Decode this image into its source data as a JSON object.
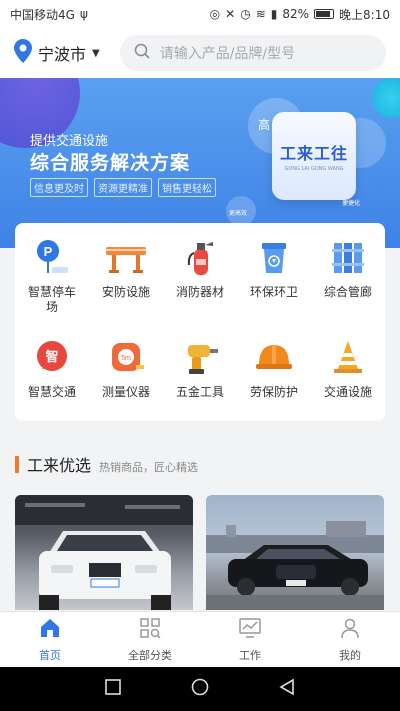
{
  "status": {
    "carrier": "中国移动4G",
    "battery": "82%",
    "time": "晚上8:10"
  },
  "header": {
    "city": "宁波市",
    "search_placeholder": "请输入产品/品牌/型号"
  },
  "banner": {
    "subtitle": "提供交通设施",
    "title": "综合服务解决方案",
    "tags": [
      "信息更及时",
      "资源更精准",
      "销售更轻松"
    ],
    "side_text": "高",
    "logo_text": "工来工往",
    "logo_pinyin": "GONG LAI GONG WANG",
    "bubble_text_1": "更高效",
    "bubble_text_2": "便捷化"
  },
  "categories": [
    {
      "label": "智慧停车场",
      "icon": "smart-parking-icon"
    },
    {
      "label": "安防设施",
      "icon": "barrier-icon"
    },
    {
      "label": "消防器材",
      "icon": "fire-extinguisher-icon"
    },
    {
      "label": "环保环卫",
      "icon": "trash-bin-icon"
    },
    {
      "label": "综合管廊",
      "icon": "pipe-gallery-icon"
    },
    {
      "label": "智慧交通",
      "icon": "smart-traffic-icon"
    },
    {
      "label": "测量仪器",
      "icon": "tape-measure-icon"
    },
    {
      "label": "五金工具",
      "icon": "drill-icon"
    },
    {
      "label": "劳保防护",
      "icon": "hard-hat-icon"
    },
    {
      "label": "交通设施",
      "icon": "traffic-cone-icon"
    }
  ],
  "section": {
    "title": "工来优选",
    "subtitle": "热销商品，匠心精选"
  },
  "products": [
    {
      "icon": "white-suv-photo"
    },
    {
      "icon": "black-sedan-photo"
    }
  ],
  "tabbar": [
    {
      "label": "首页",
      "icon": "home-icon",
      "active": true
    },
    {
      "label": "全部分类",
      "icon": "category-icon",
      "active": false
    },
    {
      "label": "工作",
      "icon": "work-icon",
      "active": false
    },
    {
      "label": "我的",
      "icon": "user-icon",
      "active": false
    }
  ],
  "colors": {
    "accent": "#2f77e6",
    "banner": "#3f82e6",
    "section_bar": "#f07a2a"
  }
}
